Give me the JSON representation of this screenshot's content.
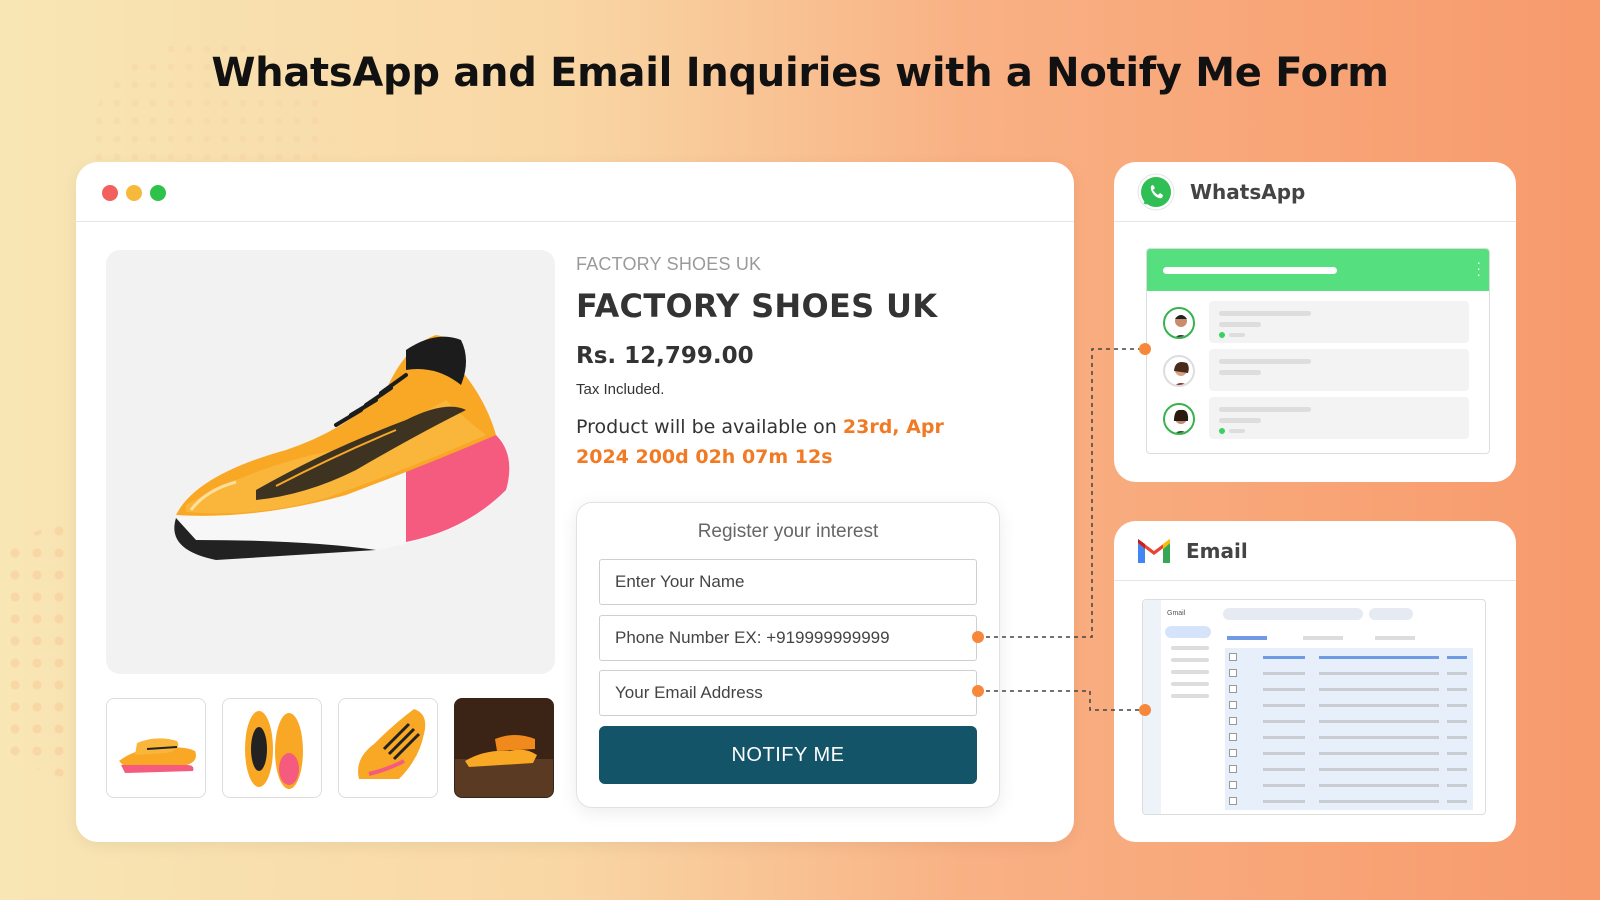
{
  "headline": "WhatsApp and Email Inquiries with a Notify Me Form",
  "product": {
    "vendor": "FACTORY SHOES UK",
    "title": "FACTORY SHOES UK",
    "price": "Rs. 12,799.00",
    "tax_note": "Tax Included.",
    "availability_prefix": "Product will be available on ",
    "availability_date": "23rd, Apr 2024 200d 02h 07m 12s"
  },
  "form": {
    "title": "Register your interest",
    "name_placeholder": "Enter Your Name",
    "phone_placeholder": "Phone Number EX: +919999999999",
    "email_placeholder": "Your Email Address",
    "submit_label": "NOTIFY ME"
  },
  "whatsapp_card": {
    "label": "WhatsApp",
    "icon": "whatsapp-icon"
  },
  "email_card": {
    "label": "Email",
    "icon": "gmail-icon",
    "app_name": "Gmail"
  },
  "colors": {
    "accent_orange": "#f07b24",
    "button": "#135468",
    "whatsapp_green": "#55df7f"
  }
}
